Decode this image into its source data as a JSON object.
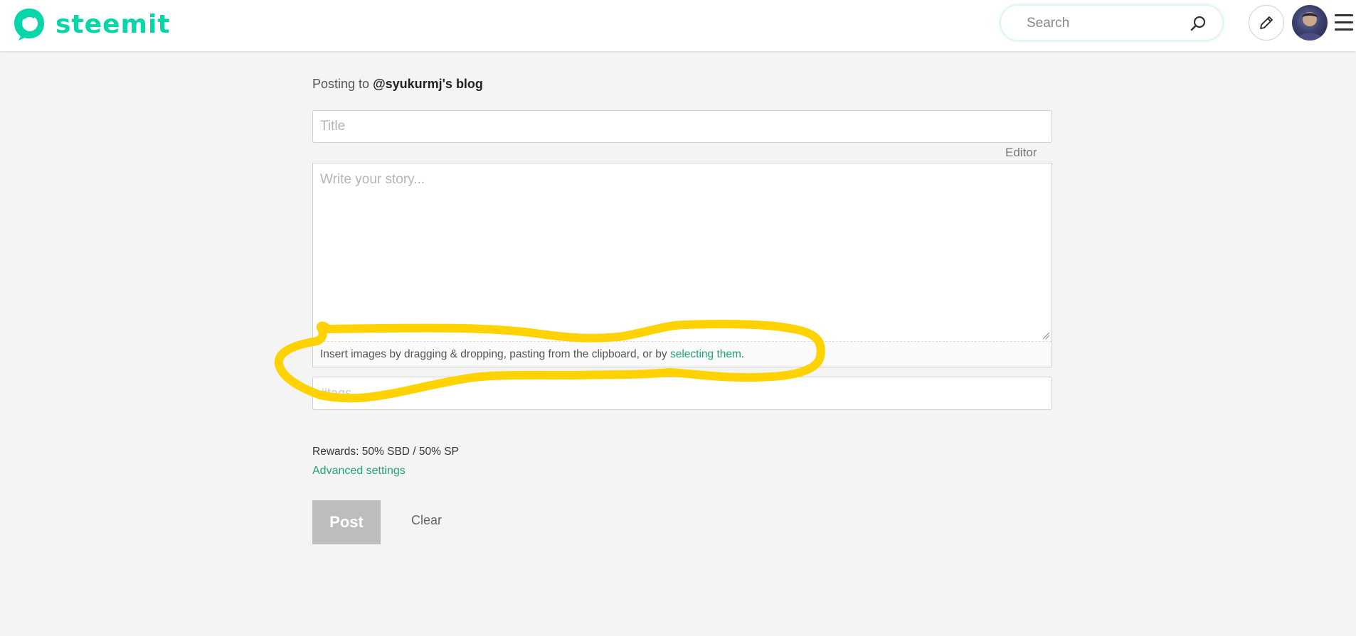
{
  "header": {
    "brand": "steemit",
    "brand_color": "#06d6a9",
    "search": {
      "placeholder": "Search",
      "value": ""
    },
    "icons": [
      "steemit-logo-icon",
      "search-icon",
      "pencil-icon",
      "avatar",
      "hamburger-menu-icon"
    ]
  },
  "composer": {
    "posting_to_prefix": "Posting to ",
    "posting_to_target": "@syukurmj's blog",
    "title_placeholder": "Title",
    "editor_label": "Editor",
    "story_placeholder": "Write your story...",
    "insert_text": "Insert images by dragging & dropping, pasting from the clipboard, or by ",
    "insert_link": "selecting them",
    "insert_suffix": ".",
    "tags_placeholder": "#tags",
    "rewards": "Rewards: 50% SBD / 50% SP",
    "advanced_settings": "Advanced settings",
    "post_label": "Post",
    "clear_label": "Clear"
  },
  "colors": {
    "link": "#1fa37a",
    "annotation_highlight": "#ffd200",
    "post_button_disabled": "#bdbdbd"
  }
}
